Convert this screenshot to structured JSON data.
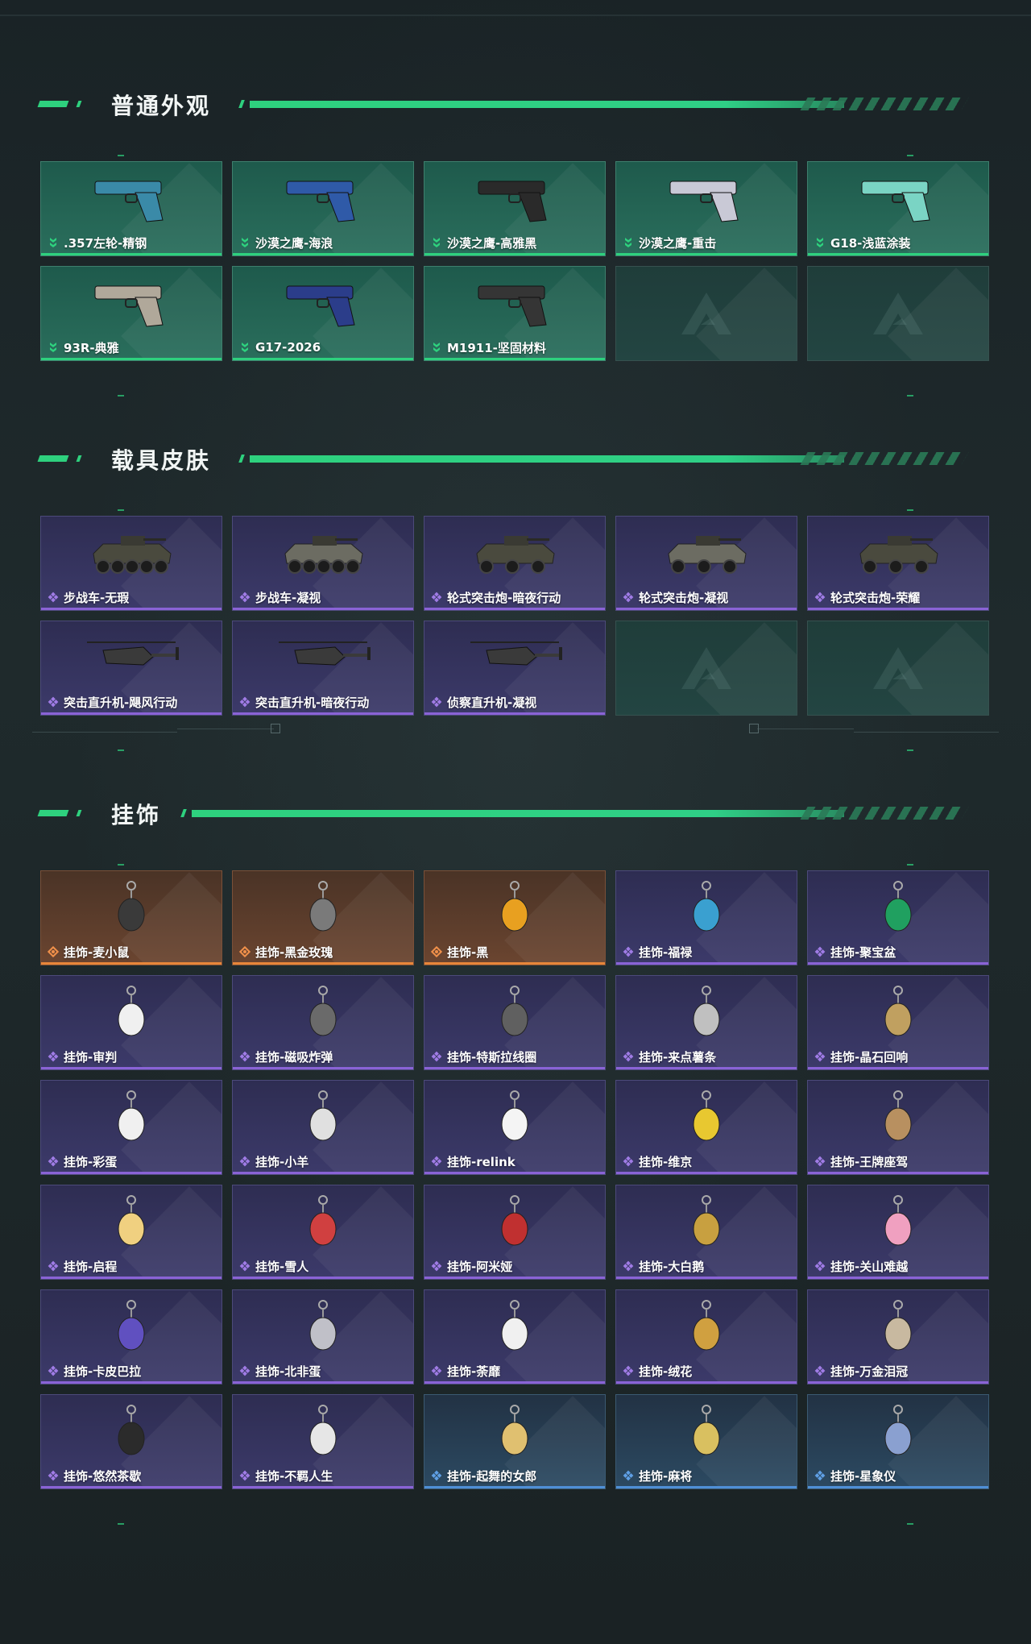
{
  "colors": {
    "accent_green": "#2ed17e",
    "rarity_green": "#2ed17e",
    "rarity_purple": "#8a63d6",
    "rarity_orange": "#e8863a",
    "rarity_blue": "#4f8fd6"
  },
  "sections": [
    {
      "title": "普通外观",
      "items": [
        {
          "label": ".357左轮-精钢",
          "rarity": "gun",
          "icon": "revolver-icon"
        },
        {
          "label": "沙漠之鹰-海浪",
          "rarity": "gun",
          "icon": "pistol-icon"
        },
        {
          "label": "沙漠之鹰-高雅黑",
          "rarity": "gun",
          "icon": "pistol-icon"
        },
        {
          "label": "沙漠之鹰-重击",
          "rarity": "gun",
          "icon": "pistol-icon"
        },
        {
          "label": "G18-浅蓝涂装",
          "rarity": "gun",
          "icon": "pistol-icon"
        },
        {
          "label": "93R-典雅",
          "rarity": "gun",
          "icon": "pistol-icon"
        },
        {
          "label": "G17-2026",
          "rarity": "gun",
          "icon": "pistol-icon"
        },
        {
          "label": "M1911-坚固材料",
          "rarity": "gun",
          "icon": "pistol-icon"
        },
        {
          "label": "",
          "rarity": "empty",
          "icon": "placeholder-logo-icon"
        },
        {
          "label": "",
          "rarity": "empty",
          "icon": "placeholder-logo-icon"
        }
      ]
    },
    {
      "title": "载具皮肤",
      "items": [
        {
          "label": "步战车-无瑕",
          "rarity": "purple",
          "icon": "apc-icon"
        },
        {
          "label": "步战车-凝视",
          "rarity": "purple",
          "icon": "apc-icon"
        },
        {
          "label": "轮式突击炮-暗夜行动",
          "rarity": "purple",
          "icon": "armored-car-icon"
        },
        {
          "label": "轮式突击炮-凝视",
          "rarity": "purple",
          "icon": "armored-car-icon"
        },
        {
          "label": "轮式突击炮-荣耀",
          "rarity": "purple",
          "icon": "armored-car-icon"
        },
        {
          "label": "突击直升机-飓风行动",
          "rarity": "purple",
          "icon": "helicopter-icon"
        },
        {
          "label": "突击直升机-暗夜行动",
          "rarity": "purple",
          "icon": "helicopter-icon"
        },
        {
          "label": "侦察直升机-凝视",
          "rarity": "purple",
          "icon": "helicopter-icon"
        },
        {
          "label": "",
          "rarity": "empty",
          "icon": "placeholder-logo-icon"
        },
        {
          "label": "",
          "rarity": "empty",
          "icon": "placeholder-logo-icon"
        }
      ]
    },
    {
      "title": "挂饰",
      "items": [
        {
          "label": "挂饰-麦小鼠",
          "rarity": "orange",
          "icon": "charm-icon"
        },
        {
          "label": "挂饰-黑金玫瑰",
          "rarity": "orange",
          "icon": "charm-icon"
        },
        {
          "label": "挂饰-黑",
          "rarity": "orange",
          "icon": "charm-icon"
        },
        {
          "label": "挂饰-福禄",
          "rarity": "purple",
          "icon": "charm-icon"
        },
        {
          "label": "挂饰-聚宝盆",
          "rarity": "purple",
          "icon": "charm-icon"
        },
        {
          "label": "挂饰-审判",
          "rarity": "purple",
          "icon": "charm-icon"
        },
        {
          "label": "挂饰-磁吸炸弹",
          "rarity": "purple",
          "icon": "charm-icon"
        },
        {
          "label": "挂饰-特斯拉线圈",
          "rarity": "purple",
          "icon": "charm-icon"
        },
        {
          "label": "挂饰-来点薯条",
          "rarity": "purple",
          "icon": "charm-icon"
        },
        {
          "label": "挂饰-晶石回响",
          "rarity": "purple",
          "icon": "charm-icon"
        },
        {
          "label": "挂饰-彩蛋",
          "rarity": "purple",
          "icon": "charm-icon"
        },
        {
          "label": "挂饰-小羊",
          "rarity": "purple",
          "icon": "charm-icon"
        },
        {
          "label": "挂饰-relink",
          "rarity": "purple",
          "icon": "charm-icon"
        },
        {
          "label": "挂饰-维京",
          "rarity": "purple",
          "icon": "charm-icon"
        },
        {
          "label": "挂饰-王牌座驾",
          "rarity": "purple",
          "icon": "charm-icon"
        },
        {
          "label": "挂饰-启程",
          "rarity": "purple",
          "icon": "charm-icon"
        },
        {
          "label": "挂饰-雪人",
          "rarity": "purple",
          "icon": "charm-icon"
        },
        {
          "label": "挂饰-阿米娅",
          "rarity": "purple",
          "icon": "charm-icon"
        },
        {
          "label": "挂饰-大白鹅",
          "rarity": "purple",
          "icon": "charm-icon"
        },
        {
          "label": "挂饰-关山难越",
          "rarity": "purple",
          "icon": "charm-icon"
        },
        {
          "label": "挂饰-卡皮巴拉",
          "rarity": "purple",
          "icon": "charm-icon"
        },
        {
          "label": "挂饰-北非蛋",
          "rarity": "purple",
          "icon": "charm-icon"
        },
        {
          "label": "挂饰-荼靡",
          "rarity": "purple",
          "icon": "charm-icon"
        },
        {
          "label": "挂饰-绒花",
          "rarity": "purple",
          "icon": "charm-icon"
        },
        {
          "label": "挂饰-万金泪冠",
          "rarity": "purple",
          "icon": "charm-icon"
        },
        {
          "label": "挂饰-悠然茶歇",
          "rarity": "purple",
          "icon": "charm-icon"
        },
        {
          "label": "挂饰-不羁人生",
          "rarity": "purple",
          "icon": "charm-icon"
        },
        {
          "label": "挂饰-起舞的女郎",
          "rarity": "blue",
          "icon": "charm-icon"
        },
        {
          "label": "挂饰-麻将",
          "rarity": "blue",
          "icon": "charm-icon"
        },
        {
          "label": "挂饰-星象仪",
          "rarity": "blue",
          "icon": "charm-icon"
        }
      ]
    }
  ]
}
